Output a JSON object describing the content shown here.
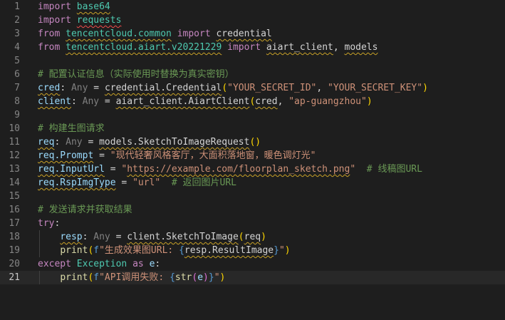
{
  "editor": {
    "lines": [
      {
        "n": "1",
        "tokens": [
          [
            "kw",
            "import"
          ],
          [
            "plain",
            " "
          ],
          [
            "cls",
            "base64",
            "squig"
          ]
        ]
      },
      {
        "n": "2",
        "tokens": [
          [
            "kw",
            "import"
          ],
          [
            "plain",
            " "
          ],
          [
            "cls",
            "requests",
            "squig-red"
          ]
        ]
      },
      {
        "n": "3",
        "tokens": [
          [
            "kw",
            "from"
          ],
          [
            "plain",
            " "
          ],
          [
            "cls",
            "tencentcloud.common",
            "squig"
          ],
          [
            "plain",
            " "
          ],
          [
            "kw",
            "import"
          ],
          [
            "plain",
            " "
          ],
          [
            "plain",
            "credential",
            "squig"
          ]
        ]
      },
      {
        "n": "4",
        "tokens": [
          [
            "kw",
            "from"
          ],
          [
            "plain",
            " "
          ],
          [
            "cls",
            "tencentcloud.aiart.v20221229",
            "squig"
          ],
          [
            "plain",
            " "
          ],
          [
            "kw",
            "import"
          ],
          [
            "plain",
            " "
          ],
          [
            "plain",
            "aiart_client",
            "squig"
          ],
          [
            "plain",
            ", "
          ],
          [
            "plain",
            "models",
            "squig"
          ]
        ]
      },
      {
        "n": "5",
        "tokens": []
      },
      {
        "n": "6",
        "tokens": [
          [
            "cm",
            "# 配置认证信息（实际使用时替换为真实密钥）"
          ]
        ]
      },
      {
        "n": "7",
        "tokens": [
          [
            "var",
            "cred",
            "squig"
          ],
          [
            "plain",
            ": "
          ],
          [
            "param",
            "Any"
          ],
          [
            "plain",
            " = "
          ],
          [
            "plain",
            "credential.Credential",
            "squig"
          ],
          [
            "brk-y",
            "("
          ],
          [
            "str",
            "\"YOUR_SECRET_ID\""
          ],
          [
            "plain",
            ", "
          ],
          [
            "str",
            "\"YOUR_SECRET_KEY\""
          ],
          [
            "brk-y",
            ")"
          ]
        ]
      },
      {
        "n": "8",
        "tokens": [
          [
            "var",
            "client",
            "squig"
          ],
          [
            "plain",
            ": "
          ],
          [
            "param",
            "Any"
          ],
          [
            "plain",
            " = "
          ],
          [
            "plain",
            "aiart_client.AiartClient",
            "squig"
          ],
          [
            "brk-y",
            "("
          ],
          [
            "plain",
            "cred",
            "squig"
          ],
          [
            "plain",
            ", "
          ],
          [
            "str",
            "\"ap-guangzhou\""
          ],
          [
            "brk-y",
            ")"
          ]
        ]
      },
      {
        "n": "9",
        "tokens": []
      },
      {
        "n": "10",
        "tokens": [
          [
            "cm",
            "# 构建生图请求"
          ]
        ]
      },
      {
        "n": "11",
        "tokens": [
          [
            "var",
            "req",
            "squig"
          ],
          [
            "plain",
            ": "
          ],
          [
            "param",
            "Any"
          ],
          [
            "plain",
            " = "
          ],
          [
            "plain",
            "models.SketchToImageRequest",
            "squig"
          ],
          [
            "brk-y",
            "()"
          ]
        ]
      },
      {
        "n": "12",
        "tokens": [
          [
            "var",
            "req.Prompt",
            "squig"
          ],
          [
            "plain",
            " = "
          ],
          [
            "str",
            "\"现代轻奢风格客厅，大面积落地窗，暖色调灯光\""
          ]
        ]
      },
      {
        "n": "13",
        "tokens": [
          [
            "var",
            "req.InputUrl",
            "squig"
          ],
          [
            "plain",
            " = "
          ],
          [
            "str",
            "\""
          ],
          [
            "str",
            "https://example.com/floorplan_sketch.png",
            "squig"
          ],
          [
            "str",
            "\""
          ],
          [
            "plain",
            "  "
          ],
          [
            "cm",
            "# 线稿图URL"
          ]
        ]
      },
      {
        "n": "14",
        "tokens": [
          [
            "var",
            "req.RspImgType",
            "squig"
          ],
          [
            "plain",
            " = "
          ],
          [
            "str",
            "\"url\""
          ],
          [
            "plain",
            "  "
          ],
          [
            "cm",
            "# 返回图片URL"
          ]
        ]
      },
      {
        "n": "15",
        "tokens": []
      },
      {
        "n": "16",
        "tokens": [
          [
            "cm",
            "# 发送请求并获取结果"
          ]
        ]
      },
      {
        "n": "17",
        "tokens": [
          [
            "kw",
            "try"
          ],
          [
            "plain",
            ":"
          ]
        ]
      },
      {
        "n": "18",
        "tokens": [
          [
            "plain",
            "    "
          ],
          [
            "var",
            "resp",
            "squig"
          ],
          [
            "plain",
            ": "
          ],
          [
            "param",
            "Any"
          ],
          [
            "plain",
            " = "
          ],
          [
            "plain",
            "client.SketchToImage",
            "squig"
          ],
          [
            "brk-y",
            "("
          ],
          [
            "plain",
            "req",
            "squig"
          ],
          [
            "brk-y",
            ")"
          ]
        ]
      },
      {
        "n": "19",
        "tokens": [
          [
            "plain",
            "    "
          ],
          [
            "fn",
            "print"
          ],
          [
            "brk-y",
            "("
          ],
          [
            "brace",
            "f"
          ],
          [
            "str",
            "\"生成效果图URL: "
          ],
          [
            "brace",
            "{"
          ],
          [
            "plain",
            "resp.ResultImage",
            "squig"
          ],
          [
            "brace",
            "}"
          ],
          [
            "str",
            "\""
          ],
          [
            "brk-y",
            ")"
          ]
        ]
      },
      {
        "n": "20",
        "tokens": [
          [
            "kw",
            "except"
          ],
          [
            "plain",
            " "
          ],
          [
            "cls",
            "Exception"
          ],
          [
            "plain",
            " "
          ],
          [
            "kw",
            "as"
          ],
          [
            "plain",
            " "
          ],
          [
            "var",
            "e"
          ],
          [
            "plain",
            ":"
          ]
        ]
      },
      {
        "n": "21",
        "tokens": [
          [
            "plain",
            "    "
          ],
          [
            "fn",
            "print"
          ],
          [
            "brk-y",
            "("
          ],
          [
            "brace",
            "f"
          ],
          [
            "str",
            "\"API调用失败: "
          ],
          [
            "brace",
            "{"
          ],
          [
            "fn",
            "str"
          ],
          [
            "brk-p",
            "("
          ],
          [
            "var",
            "e"
          ],
          [
            "brk-p",
            ")"
          ],
          [
            "brace",
            "}"
          ],
          [
            "str",
            "\""
          ],
          [
            "brk-y",
            ")"
          ]
        ]
      }
    ],
    "current_line": "21"
  }
}
